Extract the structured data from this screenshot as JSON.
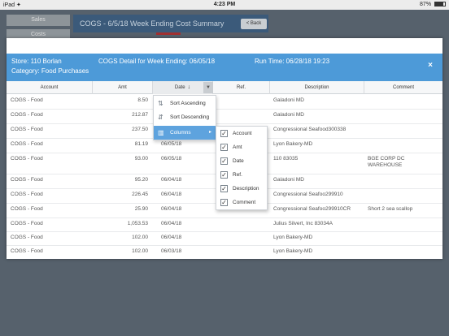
{
  "status_bar": {
    "left": "iPad ✦",
    "time": "4:23 PM",
    "battery": "87%"
  },
  "background": {
    "side_items": [
      "Sales",
      "Costs"
    ],
    "header_title": "COGS - 6/5/18 Week Ending Cost Summary",
    "back_label": "< Back"
  },
  "modal": {
    "store": "Store: 110 Borlan",
    "cogs_detail": "COGS Detail for Week Ending: 06/05/18",
    "run_time": "Run Time: 06/28/18 19:23",
    "category": "Category: Food Purchases",
    "close_glyph": "×"
  },
  "columns": {
    "account": "Account",
    "amt": "Amt",
    "date": "Date",
    "date_sort_glyph": "↓",
    "menu_glyph": "▼",
    "ref": "Ref.",
    "description": "Description",
    "comment": "Comment"
  },
  "rows": [
    {
      "account": "COGS - Food",
      "amt": "8.50",
      "date": "",
      "ref": "",
      "description": "Galadoni MD",
      "comment": ""
    },
    {
      "account": "COGS - Food",
      "amt": "212.87",
      "date": "",
      "ref": "",
      "description": "Galadoni MD",
      "comment": ""
    },
    {
      "account": "COGS - Food",
      "amt": "237.50",
      "date": "",
      "ref": "",
      "description": "Congressional Seafood300338",
      "comment": ""
    },
    {
      "account": "COGS - Food",
      "amt": "81.19",
      "date": "06/05/18",
      "ref": "",
      "description": "Lyon Bakery-MD",
      "comment": ""
    },
    {
      "account": "COGS - Food",
      "amt": "93.00",
      "date": "06/05/18",
      "ref": "",
      "description": "110 83035",
      "comment": "BGE CORP DC WAREHOUSE"
    },
    {
      "account": "COGS - Food",
      "amt": "95.20",
      "date": "06/04/18",
      "ref": "",
      "description": "Galadoni MD",
      "comment": ""
    },
    {
      "account": "COGS - Food",
      "amt": "226.45",
      "date": "06/04/18",
      "ref": "",
      "description": "Congressional Seafoo299910",
      "comment": ""
    },
    {
      "account": "COGS - Food",
      "amt": "25.90",
      "date": "06/04/18",
      "ref": "",
      "description": "Congressional Seafoo299910CR",
      "comment": "Short 2 sea scallop"
    },
    {
      "account": "COGS - Food",
      "amt": "1,053.53",
      "date": "06/04/18",
      "ref": "",
      "description": "Julius Silvert, Inc 83034A",
      "comment": ""
    },
    {
      "account": "COGS - Food",
      "amt": "102.00",
      "date": "06/04/18",
      "ref": "",
      "description": "Lyon Bakery-MD",
      "comment": ""
    },
    {
      "account": "COGS - Food",
      "amt": "102.00",
      "date": "06/03/18",
      "ref": "",
      "description": "Lyon Bakery-MD",
      "comment": ""
    }
  ],
  "context_menu": {
    "sort_asc": "Sort Ascending",
    "sort_desc": "Sort Descending",
    "columns": "Columns",
    "submenu_glyph": "▸"
  },
  "columns_menu": {
    "items": [
      "Account",
      "Amt",
      "Date",
      "Ref.",
      "Description",
      "Comment"
    ],
    "check_glyph": "✓"
  },
  "colors": {
    "header_blue": "#4d9ad8",
    "selected_blue": "#5ea3de",
    "overlay": "#4f5b66"
  }
}
